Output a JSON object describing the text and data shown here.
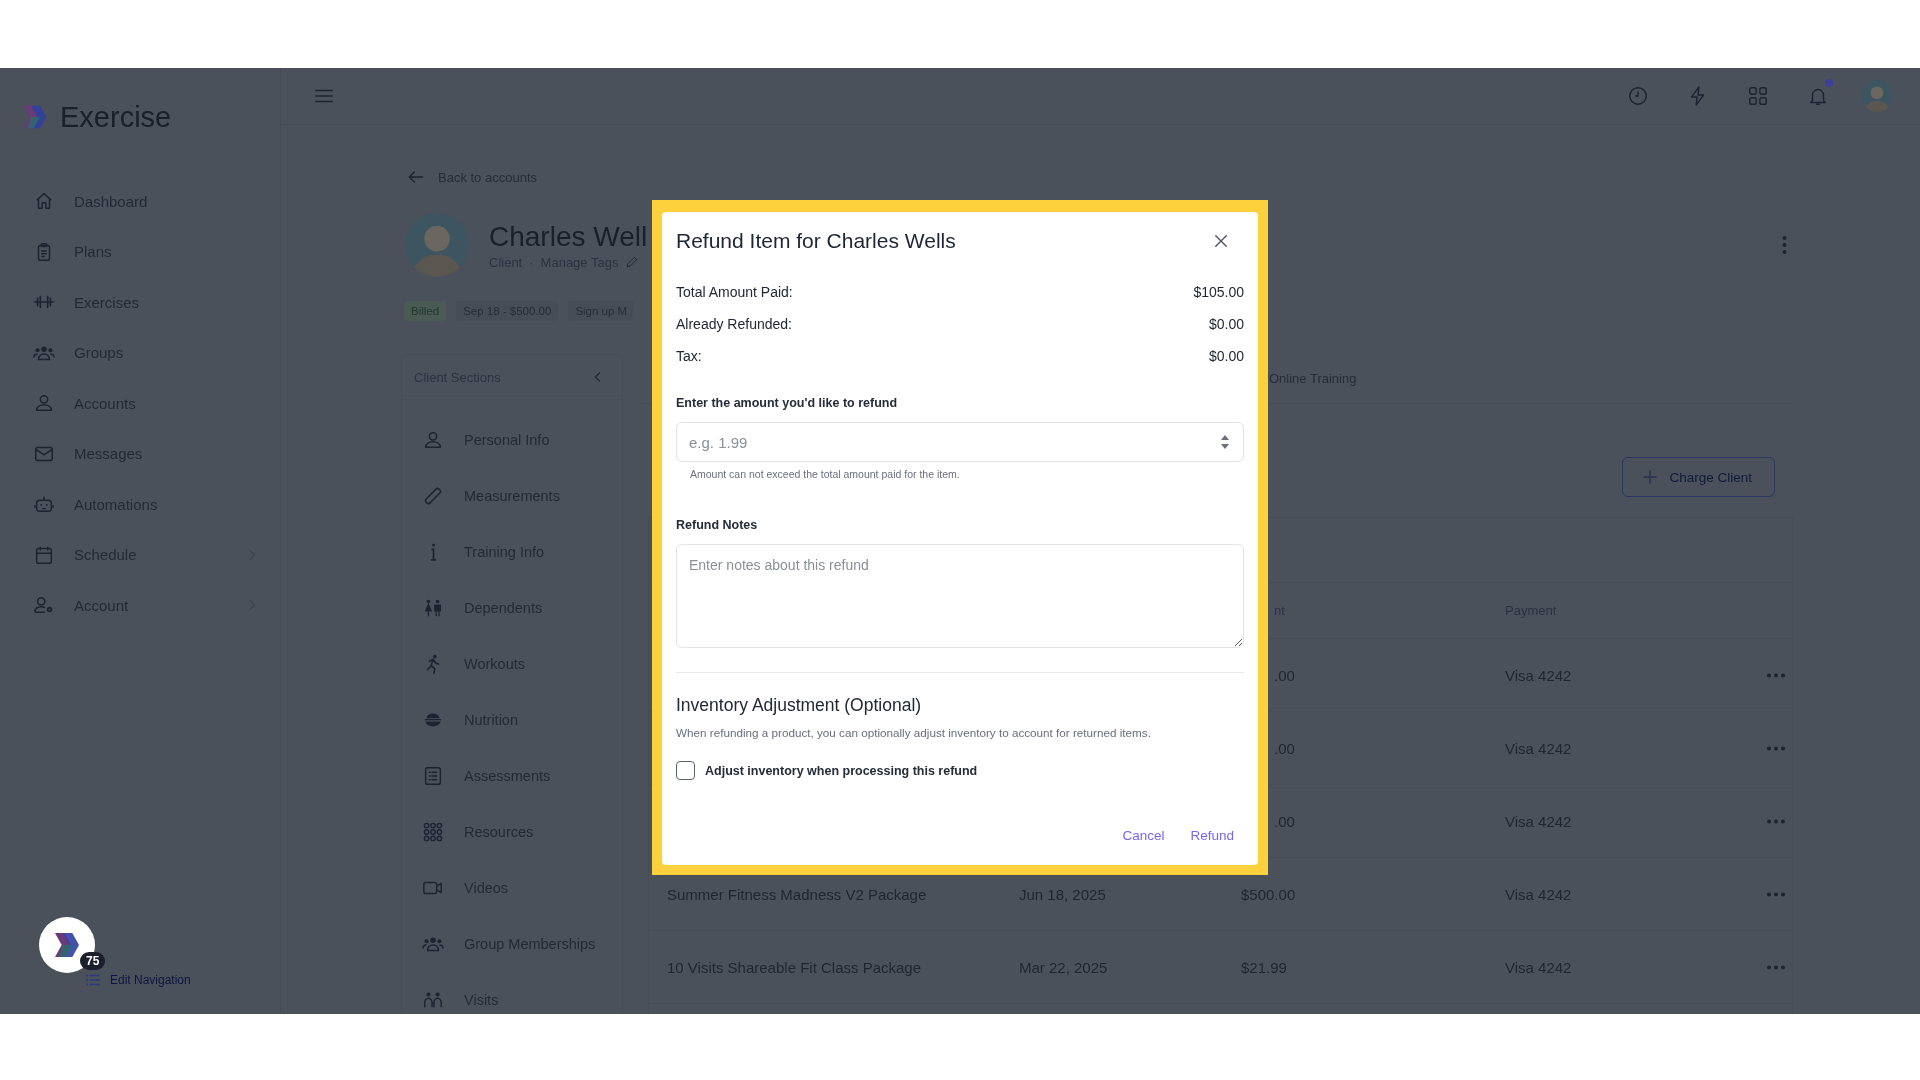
{
  "app": {
    "name": "Exercise"
  },
  "sidebar": {
    "items": [
      {
        "label": "Dashboard",
        "expandable": false
      },
      {
        "label": "Plans",
        "expandable": false
      },
      {
        "label": "Exercises",
        "expandable": false
      },
      {
        "label": "Groups",
        "expandable": false
      },
      {
        "label": "Accounts",
        "expandable": false
      },
      {
        "label": "Messages",
        "expandable": false
      },
      {
        "label": "Automations",
        "expandable": false
      },
      {
        "label": "Schedule",
        "expandable": true
      },
      {
        "label": "Account",
        "expandable": true
      }
    ],
    "edit_navigation": "Edit Navigation",
    "assistant_badge": "75"
  },
  "header": {
    "notifications_unread": true
  },
  "client": {
    "back_link": "Back to accounts",
    "name": "Charles Well",
    "role": "Client",
    "separator": "·",
    "manage_tags": "Manage Tags",
    "chips": [
      {
        "label": "Billed",
        "kind": "status"
      },
      {
        "label": "Sep 18 - $500.00",
        "kind": "plain"
      },
      {
        "label": "Sign up M",
        "kind": "plain"
      }
    ]
  },
  "client_sections": {
    "title": "Client Sections",
    "items": [
      {
        "label": "Personal Info"
      },
      {
        "label": "Measurements"
      },
      {
        "label": "Training Info"
      },
      {
        "label": "Dependents"
      },
      {
        "label": "Workouts"
      },
      {
        "label": "Nutrition"
      },
      {
        "label": "Assessments"
      },
      {
        "label": "Resources"
      },
      {
        "label": "Videos"
      },
      {
        "label": "Group Memberships"
      },
      {
        "label": "Visits"
      }
    ]
  },
  "tabs": [
    {
      "label": "Online Training"
    }
  ],
  "charge_button": "Charge Client",
  "table": {
    "columns": [
      {
        "label": "nt"
      },
      {
        "label": "Payment"
      }
    ],
    "rows": [
      {
        "amount": ".00",
        "payment": "Visa 4242"
      },
      {
        "amount": ".00",
        "payment": "Visa 4242"
      },
      {
        "amount": ".00",
        "payment": "Visa 4242"
      },
      {
        "item": "Summer Fitness Madness V2 Package",
        "date": "Jun 18, 2025",
        "amount": "$500.00",
        "payment": "Visa 4242"
      },
      {
        "item": "10 Visits Shareable Fit Class Package",
        "date": "Mar 22, 2025",
        "amount": "$21.99",
        "payment": "Visa 4242"
      }
    ]
  },
  "refund_dialog": {
    "title": "Refund Item for Charles Wells",
    "summary": [
      {
        "label": "Total Amount Paid:",
        "value": "$105.00"
      },
      {
        "label": "Already Refunded:",
        "value": "$0.00"
      },
      {
        "label": "Tax:",
        "value": "$0.00"
      }
    ],
    "amount_field": {
      "label": "Enter the amount you'd like to refund",
      "placeholder": "e.g. 1.99",
      "hint": "Amount can not exceed the total amount paid for the item."
    },
    "notes_field": {
      "label": "Refund Notes",
      "placeholder": "Enter notes about this refund"
    },
    "inventory": {
      "title": "Inventory Adjustment (Optional)",
      "description": "When refunding a product, you can optionally adjust inventory to account for returned items.",
      "checkbox": {
        "label": "Adjust inventory when processing this refund",
        "checked": false
      }
    },
    "buttons": [
      {
        "label": "Cancel"
      },
      {
        "label": "Refund"
      }
    ]
  }
}
